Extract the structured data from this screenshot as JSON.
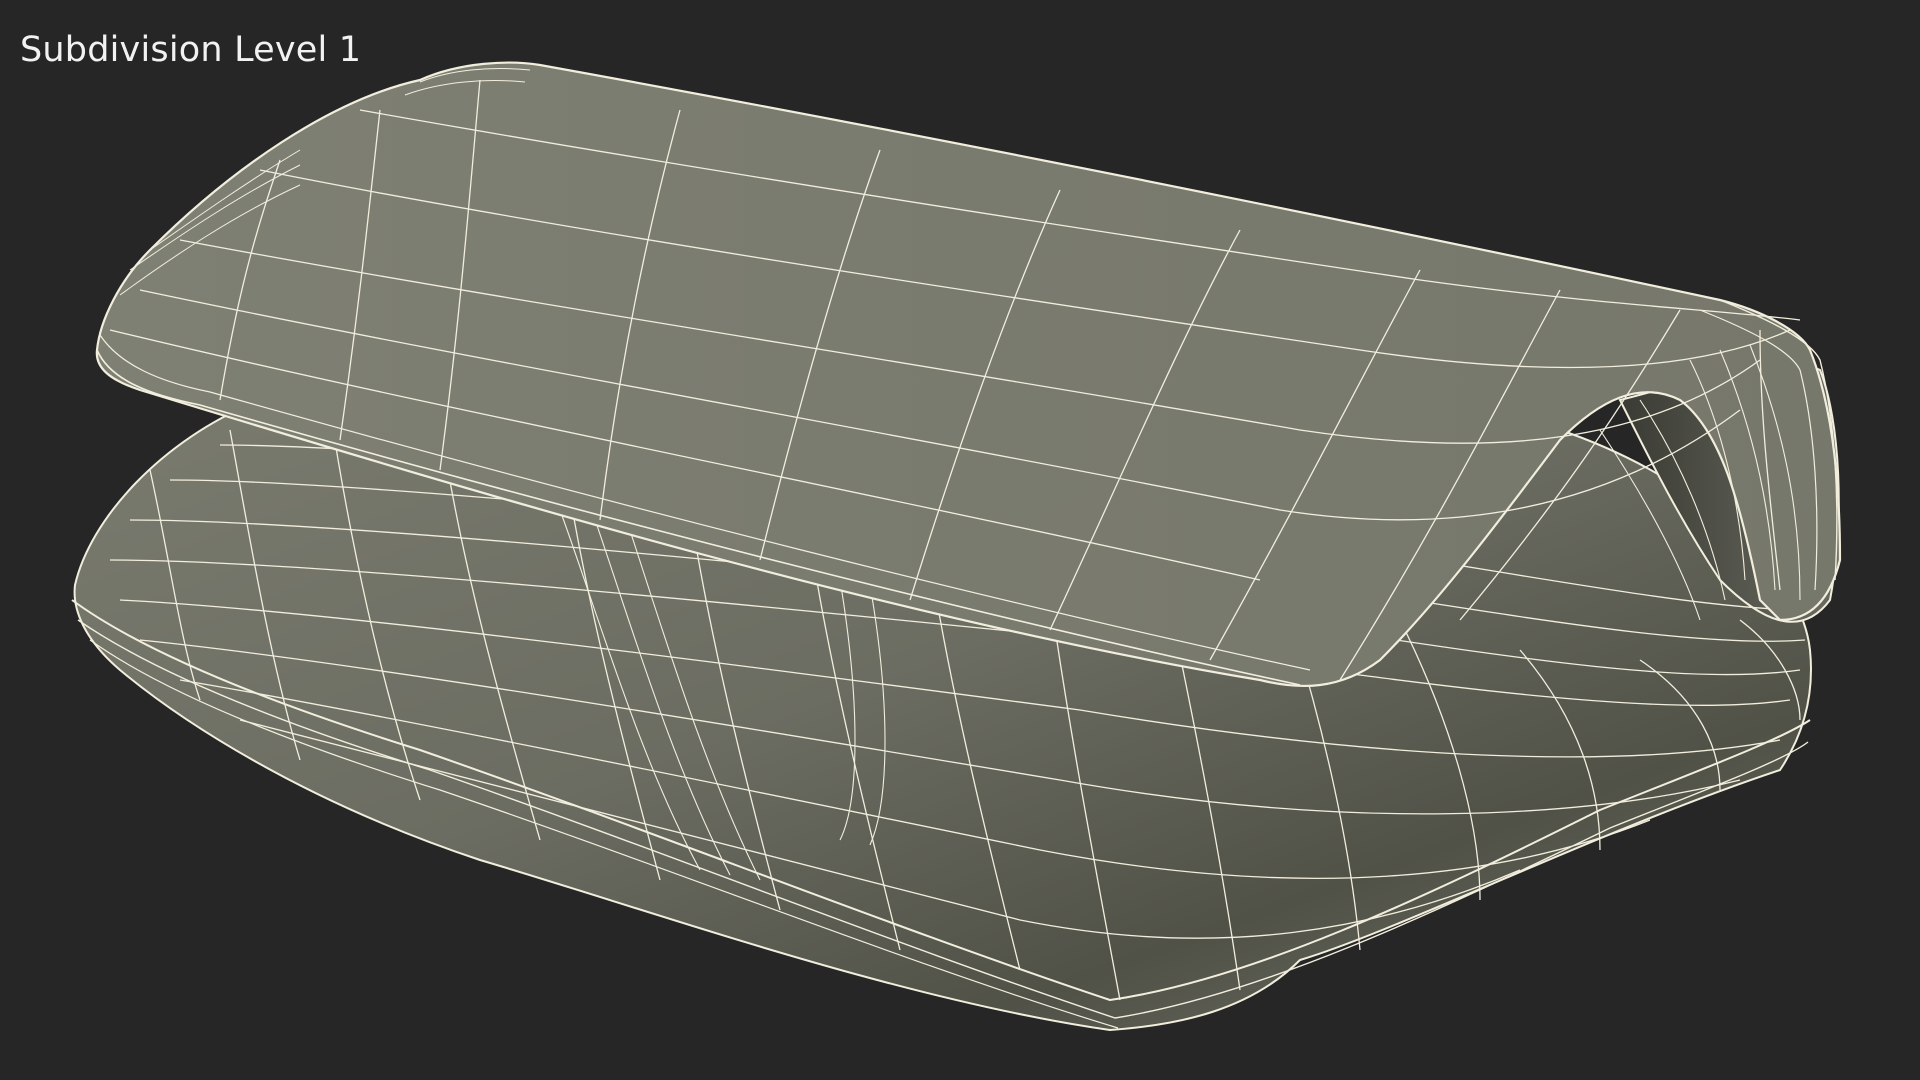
{
  "viewport": {
    "label": "Subdivision Level 1"
  },
  "colors": {
    "background": "#262626",
    "surface": "#7b7c70",
    "surface_shadow": "#4d4e45",
    "wireframe": "#f2eedd",
    "label": "#f2f2f2"
  }
}
